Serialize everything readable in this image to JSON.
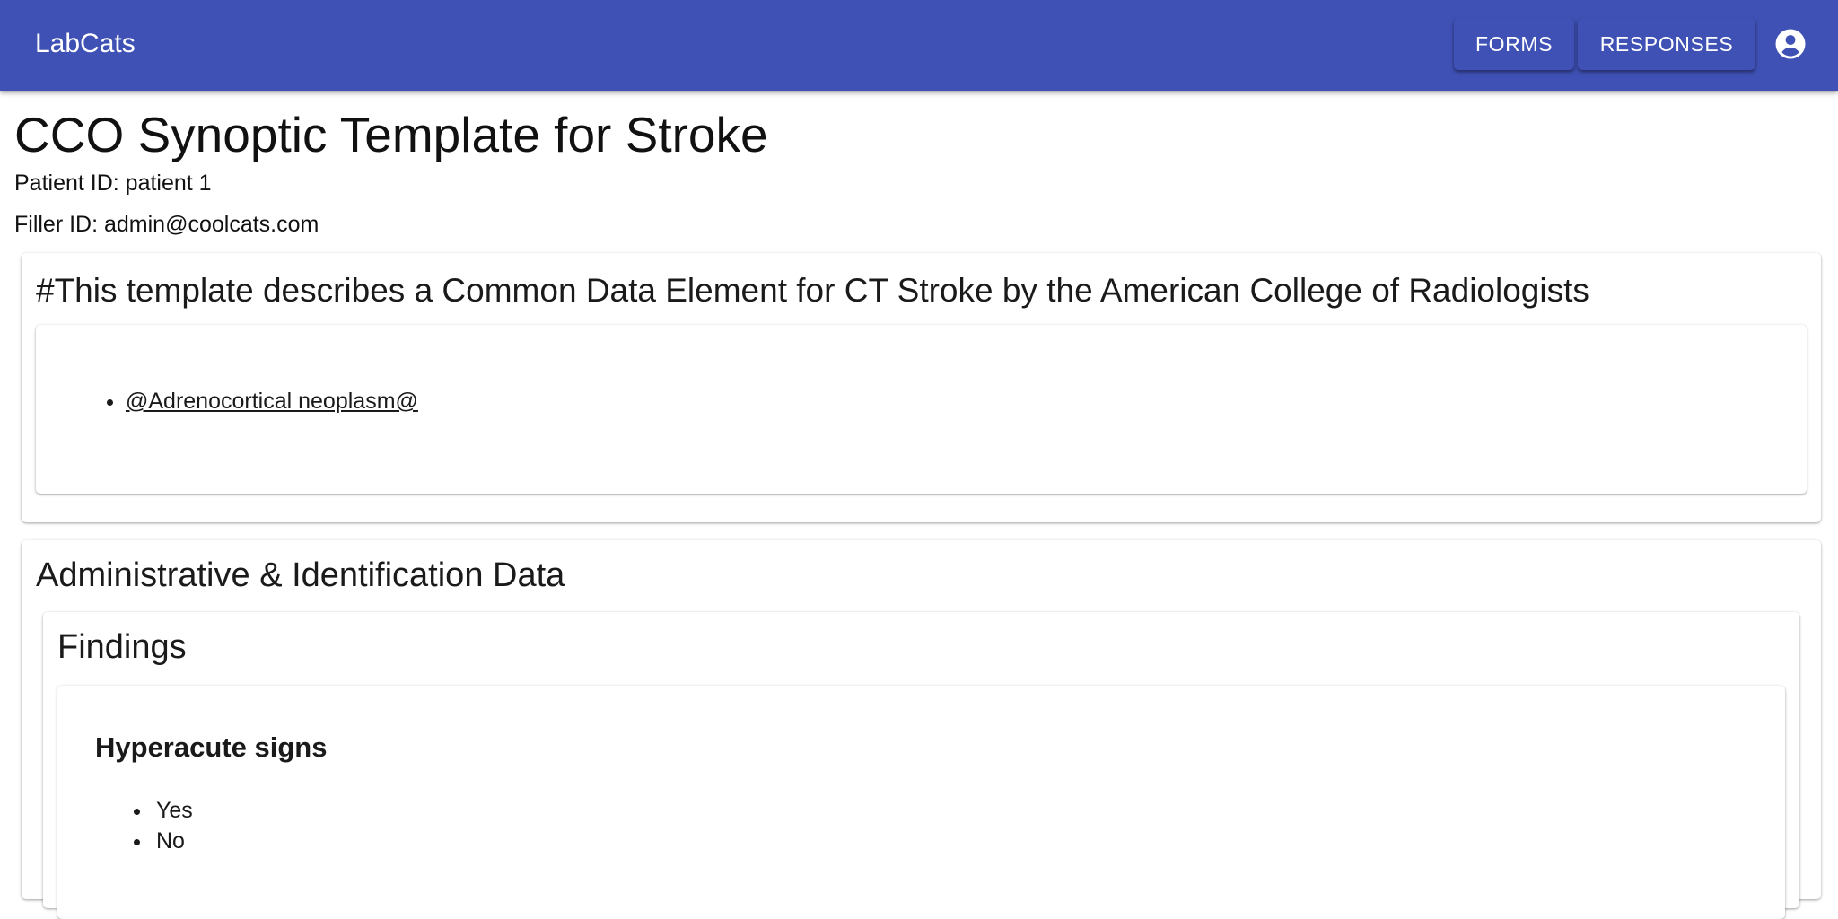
{
  "appbar": {
    "brand": "LabCats",
    "forms_label": "Forms",
    "responses_label": "Responses",
    "icon": "account-circle-icon",
    "color": "#3f51b5"
  },
  "page": {
    "title": "CCO Synoptic Template for Stroke",
    "patient_id": "Patient ID: patient 1",
    "filler_id": "Filler ID: admin@coolcats.com"
  },
  "description": {
    "title": "#This template describes a Common Data Element for CT Stroke by the American College of Radiologists",
    "items": [
      "@Adrenocortical neoplasm@"
    ]
  },
  "section": {
    "title": "Administrative & Identification Data",
    "subsection": {
      "title": "Findings",
      "question": {
        "title": "Hyperacute signs",
        "options": [
          "Yes",
          "No"
        ]
      }
    }
  }
}
